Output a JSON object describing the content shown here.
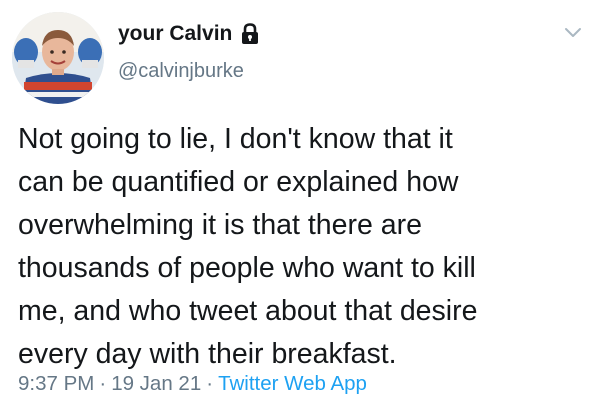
{
  "tweet": {
    "display_name": "your Calvin",
    "handle": "@calvinjburke",
    "protected_icon": "lock-icon",
    "menu_icon": "chevron-down-icon",
    "text_lines": [
      "Not going to lie, I don't know that it",
      "can be quantified or explained how",
      "overwhelming it is that there are",
      "thousands of people who want to kill",
      "me, and who tweet about that desire",
      "every day with their breakfast."
    ],
    "time": "9:37 PM",
    "separator": "·",
    "date": "19 Jan 21",
    "source": "Twitter Web App"
  },
  "colors": {
    "text": "#14171a",
    "secondary": "#657786",
    "link": "#1da1f2"
  }
}
